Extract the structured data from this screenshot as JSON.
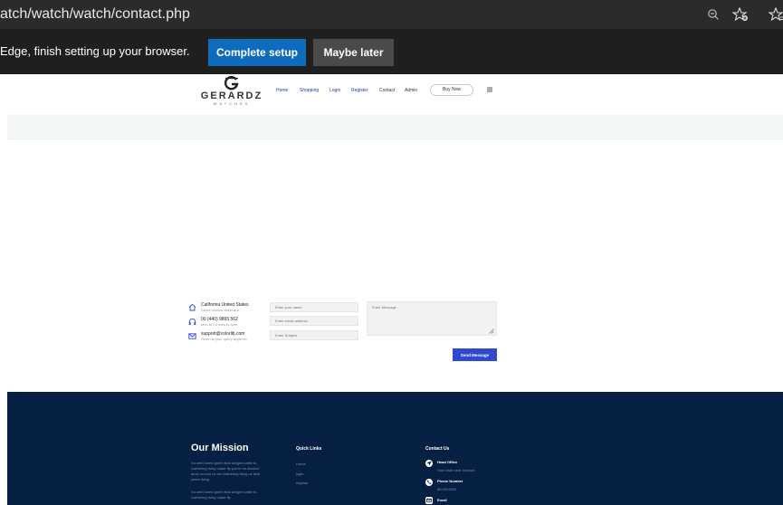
{
  "browser": {
    "url": "atch/watch/watch/contact.php"
  },
  "setup_banner": {
    "message": "Edge, finish setting up your browser.",
    "complete_label": "Complete setup",
    "later_label": "Maybe later"
  },
  "site": {
    "logo_name": "GERARDZ",
    "logo_sub": "WATCHES",
    "nav": [
      "Home",
      "Shopping",
      "Login",
      "Register",
      "Contact",
      "Admin"
    ],
    "buy_now": "Buy Now"
  },
  "contact_info": [
    {
      "title": "California United States",
      "sub": "Santa monica bullevard",
      "icon": "home-icon"
    },
    {
      "title": "00 (440) 9865 562",
      "sub": "Mon to Fri 9am to 6pm",
      "icon": "headphones-icon"
    },
    {
      "title": "support@colorlib.com",
      "sub": "Send us your query anytime!",
      "icon": "mail-icon"
    }
  ],
  "form": {
    "name_placeholder": "Enter your name",
    "email_placeholder": "Enter email address",
    "subject_placeholder": "Enter Subject",
    "message_placeholder": "Enter Message",
    "send_label": "Send Message"
  },
  "footer": {
    "mission_title": "Our Mission",
    "mission_text_1": "So seed seed green that winged cattle in. Gathering thing made fly you're no divided deep moved us lan Gathering thing us land years living.",
    "mission_text_2": "So seed seed green that winged cattle in. Gathering thing made fly",
    "quick_links_title": "Quick Links",
    "quick_links": [
      "Home",
      "login",
      "register"
    ],
    "contact_title": "Contact Us",
    "head_office_title": "Head Office",
    "head_office_value": "Vice chak near. keshod",
    "phone_title": "Phone Number",
    "phone_value": "88-0303030",
    "email_title": "Email"
  },
  "colors": {
    "footer_bg": "#062043",
    "send_button": "#2f49d1",
    "complete_button": "#0f6cbd",
    "nav_link": "#1a3aa8"
  }
}
